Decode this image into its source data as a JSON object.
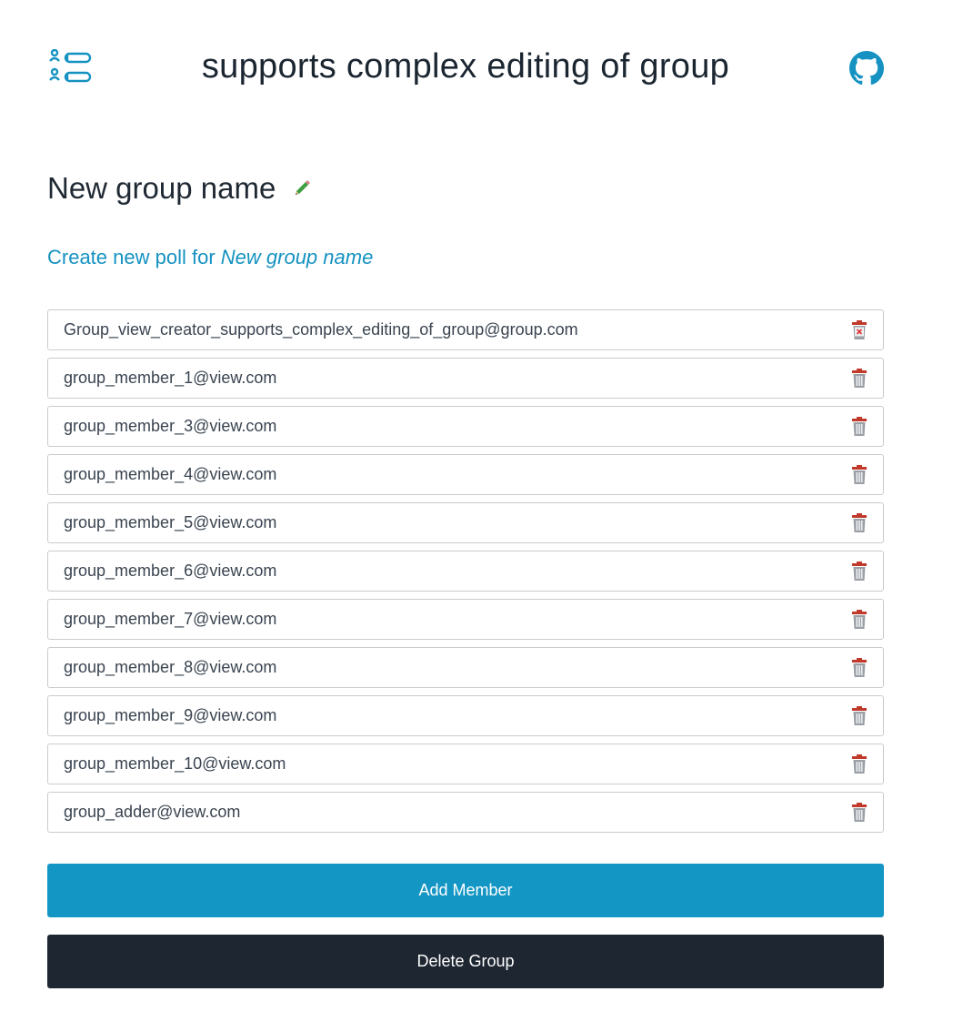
{
  "header": {
    "title": "supports complex editing of group",
    "logo_icon": "group-list-logo-icon",
    "github_icon": "github-icon",
    "accent_color": "#1592c1"
  },
  "group": {
    "name": "New group name",
    "edit_icon": "pencil-icon"
  },
  "create_poll": {
    "prefix": "Create new poll for",
    "group_name": "New group name"
  },
  "members": [
    {
      "email": "Group_view_creator_supports_complex_editing_of_group@group.com",
      "icon": "trash-cross-icon"
    },
    {
      "email": "group_member_1@view.com",
      "icon": "trash-icon"
    },
    {
      "email": "group_member_3@view.com",
      "icon": "trash-icon"
    },
    {
      "email": "group_member_4@view.com",
      "icon": "trash-icon"
    },
    {
      "email": "group_member_5@view.com",
      "icon": "trash-icon"
    },
    {
      "email": "group_member_6@view.com",
      "icon": "trash-icon"
    },
    {
      "email": "group_member_7@view.com",
      "icon": "trash-icon"
    },
    {
      "email": "group_member_8@view.com",
      "icon": "trash-icon"
    },
    {
      "email": "group_member_9@view.com",
      "icon": "trash-icon"
    },
    {
      "email": "group_member_10@view.com",
      "icon": "trash-icon"
    },
    {
      "email": "group_adder@view.com",
      "icon": "trash-icon"
    }
  ],
  "buttons": {
    "add_member": "Add Member",
    "delete_group": "Delete Group",
    "add_color": "#1496c4",
    "delete_color": "#1e2731"
  }
}
